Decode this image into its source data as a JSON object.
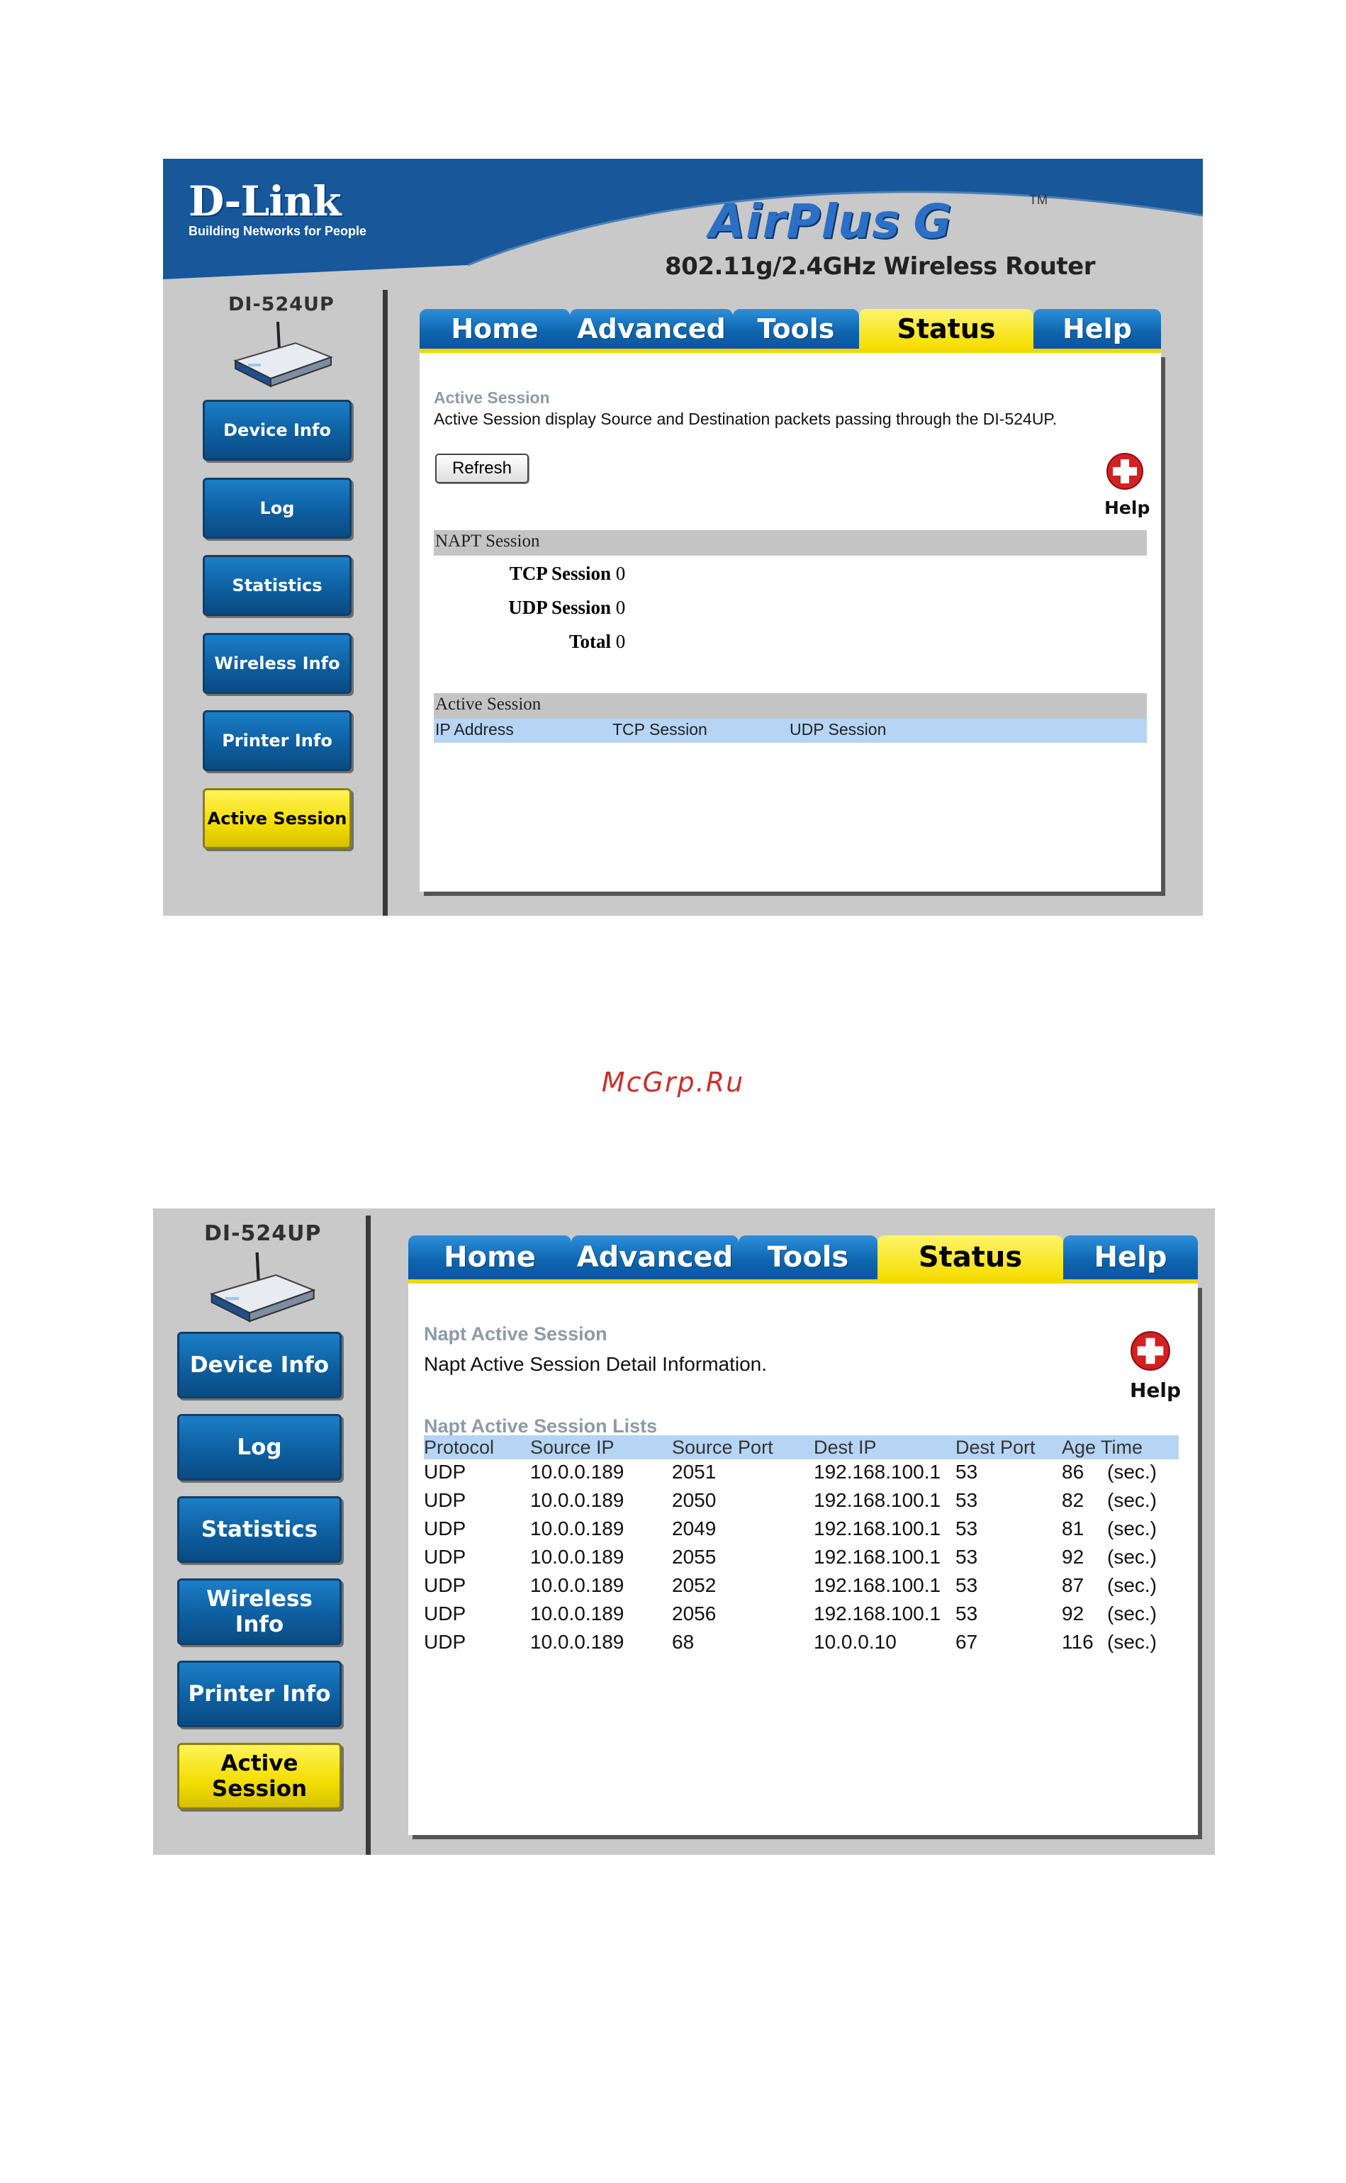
{
  "screen1": {
    "header": {
      "brand": "D-Link",
      "tagline": "Building Networks for People",
      "product": "AirPlus",
      "product_g": "G",
      "trademark": "TM",
      "subtitle": "802.11g/2.4GHz Wireless Router"
    },
    "model": "DI-524UP",
    "nav": [
      "Device Info",
      "Log",
      "Statistics",
      "Wireless Info",
      "Printer Info",
      "Active Session"
    ],
    "tabs": [
      "Home",
      "Advanced",
      "Tools",
      "Status",
      "Help"
    ],
    "content": {
      "heading": "Active Session",
      "description": "Active Session display Source and Destination packets passing through the DI-524UP.",
      "refresh_label": "Refresh",
      "help_label": "Help",
      "napt_title": "NAPT Session",
      "tcp_label": "TCP Session",
      "tcp_value": "0",
      "udp_label": "UDP Session",
      "udp_value": "0",
      "total_label": "Total",
      "total_value": "0",
      "active_title": "Active Session",
      "columns": [
        "IP Address",
        "TCP Session",
        "UDP Session"
      ]
    }
  },
  "watermark": "McGrp.Ru",
  "screen2": {
    "model": "DI-524UP",
    "nav": [
      "Device Info",
      "Log",
      "Statistics",
      "Wireless Info",
      "Printer Info",
      "Active Session"
    ],
    "tabs": [
      "Home",
      "Advanced",
      "Tools",
      "Status",
      "Help"
    ],
    "content": {
      "heading": "Napt Active Session",
      "description": "Napt Active Session Detail Information.",
      "help_label": "Help",
      "list_title": "Napt Active Session Lists",
      "columns": [
        "Protocol",
        "Source IP",
        "Source Port",
        "Dest IP",
        "Dest Port",
        "Age Time"
      ],
      "rows": [
        [
          "UDP",
          "10.0.0.189",
          "2051",
          "192.168.100.1",
          "53",
          "86",
          "(sec.)"
        ],
        [
          "UDP",
          "10.0.0.189",
          "2050",
          "192.168.100.1",
          "53",
          "82",
          "(sec.)"
        ],
        [
          "UDP",
          "10.0.0.189",
          "2049",
          "192.168.100.1",
          "53",
          "81",
          "(sec.)"
        ],
        [
          "UDP",
          "10.0.0.189",
          "2055",
          "192.168.100.1",
          "53",
          "92",
          "(sec.)"
        ],
        [
          "UDP",
          "10.0.0.189",
          "2052",
          "192.168.100.1",
          "53",
          "87",
          "(sec.)"
        ],
        [
          "UDP",
          "10.0.0.189",
          "2056",
          "192.168.100.1",
          "53",
          "92",
          "(sec.)"
        ],
        [
          "UDP",
          "10.0.0.189",
          "68",
          "10.0.0.10",
          "67",
          "116",
          "(sec.)"
        ]
      ]
    }
  },
  "colors": {
    "header_blue": "#17579a",
    "tab_blue": "#0d64ad",
    "active_yellow": "#f5dd00",
    "heading_grey": "#8d9aa8",
    "table_header_blue": "#b6d5f4",
    "watermark_red": "#c9302c"
  }
}
